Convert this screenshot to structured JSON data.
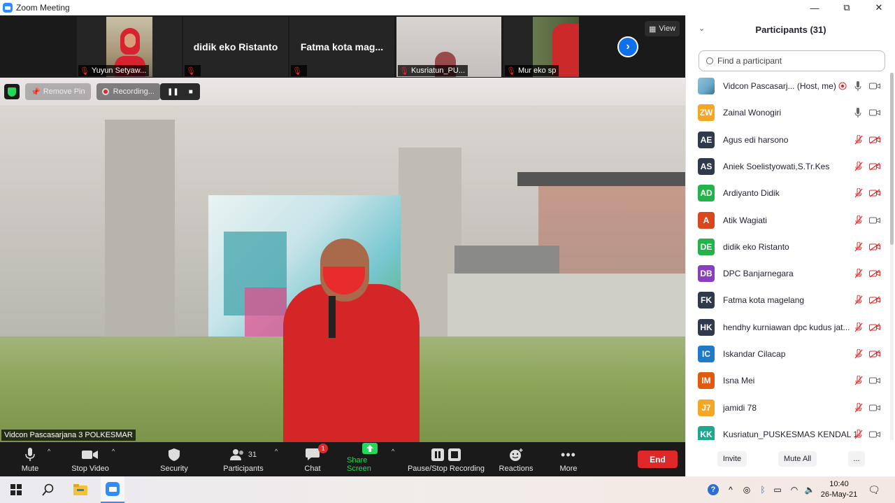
{
  "window": {
    "title": "Zoom Meeting",
    "minimize": "—",
    "restore": "⧉",
    "close": "✕"
  },
  "thumbnails": [
    {
      "label": "Yuyun Setyaw...",
      "name_overlay": ""
    },
    {
      "label": "",
      "name_overlay": "didik eko Ristanto"
    },
    {
      "label": "",
      "name_overlay": "Fatma kota mag..."
    },
    {
      "label": "Kusriatun_PU...",
      "name_overlay": ""
    },
    {
      "label": "Mur eko sp",
      "name_overlay": ""
    }
  ],
  "view_button": "View",
  "video_overlay": {
    "remove_pin": "Remove Pin",
    "recording": "Recording..."
  },
  "speaker_label": "Vidcon Pascasarjana 3 POLKESMAR",
  "toolbar": {
    "mute": "Mute",
    "stop_video": "Stop Video",
    "security": "Security",
    "participants": "Participants",
    "participants_count": "31",
    "chat": "Chat",
    "chat_badge": "1",
    "share_screen": "Share Screen",
    "pause_stop_recording": "Pause/Stop Recording",
    "reactions": "Reactions",
    "more": "More",
    "end": "End"
  },
  "panel": {
    "title": "Participants (31)",
    "search_placeholder": "Find a participant",
    "invite": "Invite",
    "mute_all": "Mute All",
    "more": "..."
  },
  "participants": [
    {
      "initials": "",
      "name": "Vidcon Pascasarj... (Host, me)",
      "color": "#6aa7c7",
      "mic": "on",
      "video": "on",
      "recording": true
    },
    {
      "initials": "ZW",
      "name": "Zainal Wonogiri",
      "color": "#f5a623",
      "mic": "on",
      "video": "on"
    },
    {
      "initials": "AE",
      "name": "Agus edi harsono",
      "color": "#2f3b4c",
      "mic": "off",
      "video": "off"
    },
    {
      "initials": "AS",
      "name": "Aniek Soelistyowati,S.Tr.Kes",
      "color": "#2f3b4c",
      "mic": "off",
      "video": "off"
    },
    {
      "initials": "AD",
      "name": "Ardiyanto Didik",
      "color": "#23b34a",
      "mic": "off",
      "video": "off"
    },
    {
      "initials": "A",
      "name": "Atik Wagiati",
      "color": "#d9471f",
      "mic": "off",
      "video": "on"
    },
    {
      "initials": "DE",
      "name": "didik eko Ristanto",
      "color": "#23b34a",
      "mic": "off",
      "video": "off"
    },
    {
      "initials": "DB",
      "name": "DPC Banjarnegara",
      "color": "#8a3fbf",
      "mic": "off",
      "video": "off"
    },
    {
      "initials": "FK",
      "name": "Fatma kota magelang",
      "color": "#2f3b4c",
      "mic": "off",
      "video": "off"
    },
    {
      "initials": "HK",
      "name": "hendhy kurniawan dpc kudus jat...",
      "color": "#2f3b4c",
      "mic": "off",
      "video": "off"
    },
    {
      "initials": "IC",
      "name": "Iskandar Cilacap",
      "color": "#1f7ac9",
      "mic": "off",
      "video": "off"
    },
    {
      "initials": "IM",
      "name": "Isna Mei",
      "color": "#e05a0f",
      "mic": "off",
      "video": "on"
    },
    {
      "initials": "J7",
      "name": "jamidi 78",
      "color": "#f5a623",
      "mic": "off",
      "video": "on"
    },
    {
      "initials": "KK",
      "name": "Kusriatun_PUSKESMAS KENDAL 1",
      "color": "#1fa88f",
      "mic": "off",
      "video": "on"
    }
  ],
  "taskbar": {
    "time": "10:40",
    "date": "26-May-21"
  },
  "colors": {
    "accent": "#0e71eb",
    "danger": "#e02828",
    "share": "#23d959"
  }
}
